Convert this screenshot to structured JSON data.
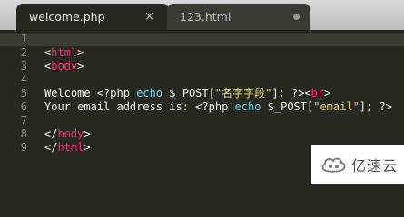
{
  "tabs": [
    {
      "label": "welcome.php",
      "active": true,
      "close_glyph": "×"
    },
    {
      "label": "123.html",
      "active": false
    }
  ],
  "editor": {
    "current_line": 1,
    "line_numbers": [
      "1",
      "2",
      "3",
      "4",
      "5",
      "6",
      "7",
      "8",
      "9"
    ],
    "lines": [
      [],
      [
        {
          "t": "<",
          "c": "plain"
        },
        {
          "t": "html",
          "c": "tag"
        },
        {
          "t": ">",
          "c": "plain"
        }
      ],
      [
        {
          "t": "<",
          "c": "plain"
        },
        {
          "t": "body",
          "c": "tag"
        },
        {
          "t": ">",
          "c": "plain"
        }
      ],
      [],
      [
        {
          "t": "Welcome <?php ",
          "c": "plain"
        },
        {
          "t": "echo",
          "c": "kw"
        },
        {
          "t": " $_POST[",
          "c": "plain"
        },
        {
          "t": "\"名字字段\"",
          "c": "str"
        },
        {
          "t": "]; ?><",
          "c": "plain"
        },
        {
          "t": "br",
          "c": "tag"
        },
        {
          "t": ">",
          "c": "plain"
        }
      ],
      [
        {
          "t": "Your email address is: <?php ",
          "c": "plain"
        },
        {
          "t": "echo",
          "c": "kw"
        },
        {
          "t": " $_POST[",
          "c": "plain"
        },
        {
          "t": "\"email\"",
          "c": "str"
        },
        {
          "t": "]; ?>",
          "c": "plain"
        }
      ],
      [],
      [
        {
          "t": "</",
          "c": "plain"
        },
        {
          "t": "body",
          "c": "tag"
        },
        {
          "t": ">",
          "c": "plain"
        }
      ],
      [
        {
          "t": "</",
          "c": "plain"
        },
        {
          "t": "html",
          "c": "tag"
        },
        {
          "t": ">",
          "c": "plain"
        }
      ]
    ]
  },
  "watermark": {
    "text": "亿速云"
  },
  "colors": {
    "tag": "#f92672",
    "keyword": "#66d9ef",
    "string": "#e6db74",
    "plain": "#f8f8f2",
    "background": "#272822"
  }
}
